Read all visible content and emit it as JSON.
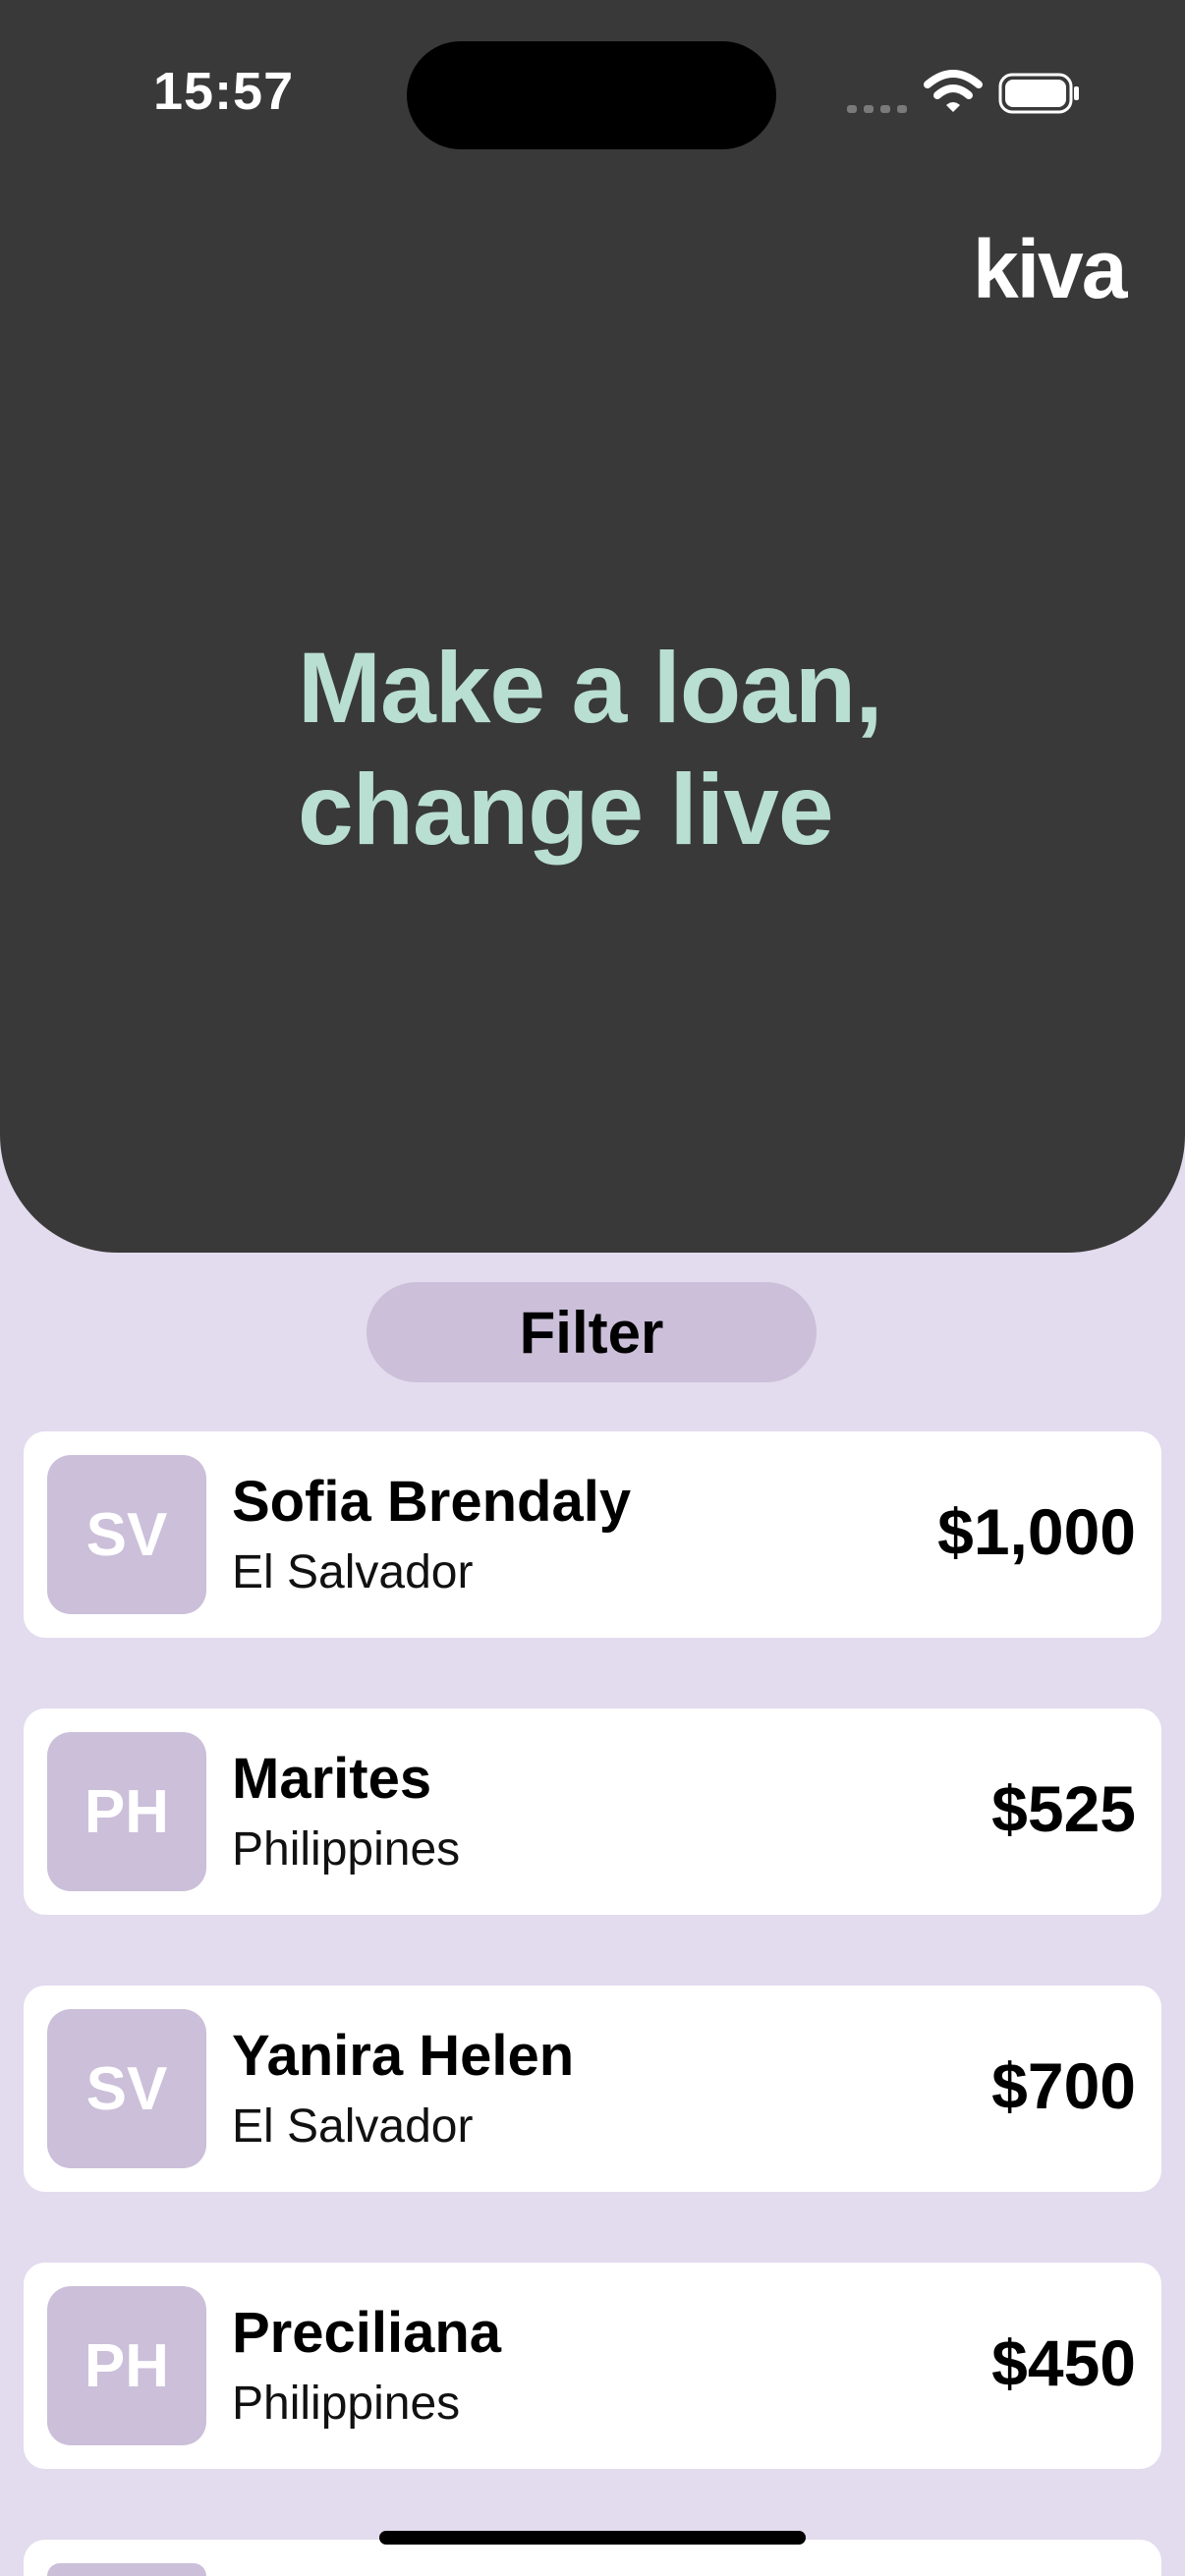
{
  "status_bar": {
    "time": "15:57"
  },
  "header": {
    "logo": "kiva",
    "tagline_line1": "Make a loan,",
    "tagline_line2": "change live"
  },
  "filter": {
    "label": "Filter"
  },
  "loans": [
    {
      "initials": "SV",
      "name": "Sofia Brendaly",
      "country": "El Salvador",
      "amount": "$1,000"
    },
    {
      "initials": "PH",
      "name": "Marites",
      "country": "Philippines",
      "amount": "$525"
    },
    {
      "initials": "SV",
      "name": "Yanira Helen",
      "country": "El Salvador",
      "amount": "$700"
    },
    {
      "initials": "PH",
      "name": "Preciliana",
      "country": "Philippines",
      "amount": "$450"
    }
  ],
  "colors": {
    "hero_bg": "#393939",
    "page_bg": "#e3dbee",
    "accent_mint": "#b9ded2",
    "badge_lavender": "#cbbfd9"
  },
  "icons": [
    "cellular-signal-icon",
    "wifi-icon",
    "battery-icon"
  ]
}
